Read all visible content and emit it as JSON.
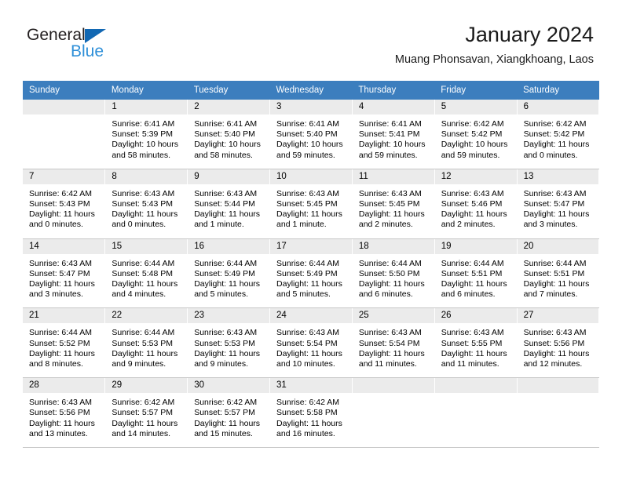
{
  "brand": {
    "name_top": "General",
    "name_bottom": "Blue",
    "triangle_color": "#1268b3",
    "blue_text_color": "#2e8fd8"
  },
  "header": {
    "title": "January 2024",
    "subtitle": "Muang Phonsavan, Xiangkhoang, Laos",
    "header_bg": "#3c7ebe",
    "header_text_color": "#ffffff",
    "daynum_bg": "#ebebeb"
  },
  "weekday_headers": [
    "Sunday",
    "Monday",
    "Tuesday",
    "Wednesday",
    "Thursday",
    "Friday",
    "Saturday"
  ],
  "weeks": [
    [
      {
        "day": "",
        "lines": [
          "",
          "",
          "",
          ""
        ]
      },
      {
        "day": "1",
        "lines": [
          "Sunrise: 6:41 AM",
          "Sunset: 5:39 PM",
          "Daylight: 10 hours",
          "and 58 minutes."
        ]
      },
      {
        "day": "2",
        "lines": [
          "Sunrise: 6:41 AM",
          "Sunset: 5:40 PM",
          "Daylight: 10 hours",
          "and 58 minutes."
        ]
      },
      {
        "day": "3",
        "lines": [
          "Sunrise: 6:41 AM",
          "Sunset: 5:40 PM",
          "Daylight: 10 hours",
          "and 59 minutes."
        ]
      },
      {
        "day": "4",
        "lines": [
          "Sunrise: 6:41 AM",
          "Sunset: 5:41 PM",
          "Daylight: 10 hours",
          "and 59 minutes."
        ]
      },
      {
        "day": "5",
        "lines": [
          "Sunrise: 6:42 AM",
          "Sunset: 5:42 PM",
          "Daylight: 10 hours",
          "and 59 minutes."
        ]
      },
      {
        "day": "6",
        "lines": [
          "Sunrise: 6:42 AM",
          "Sunset: 5:42 PM",
          "Daylight: 11 hours",
          "and 0 minutes."
        ]
      }
    ],
    [
      {
        "day": "7",
        "lines": [
          "Sunrise: 6:42 AM",
          "Sunset: 5:43 PM",
          "Daylight: 11 hours",
          "and 0 minutes."
        ]
      },
      {
        "day": "8",
        "lines": [
          "Sunrise: 6:43 AM",
          "Sunset: 5:43 PM",
          "Daylight: 11 hours",
          "and 0 minutes."
        ]
      },
      {
        "day": "9",
        "lines": [
          "Sunrise: 6:43 AM",
          "Sunset: 5:44 PM",
          "Daylight: 11 hours",
          "and 1 minute."
        ]
      },
      {
        "day": "10",
        "lines": [
          "Sunrise: 6:43 AM",
          "Sunset: 5:45 PM",
          "Daylight: 11 hours",
          "and 1 minute."
        ]
      },
      {
        "day": "11",
        "lines": [
          "Sunrise: 6:43 AM",
          "Sunset: 5:45 PM",
          "Daylight: 11 hours",
          "and 2 minutes."
        ]
      },
      {
        "day": "12",
        "lines": [
          "Sunrise: 6:43 AM",
          "Sunset: 5:46 PM",
          "Daylight: 11 hours",
          "and 2 minutes."
        ]
      },
      {
        "day": "13",
        "lines": [
          "Sunrise: 6:43 AM",
          "Sunset: 5:47 PM",
          "Daylight: 11 hours",
          "and 3 minutes."
        ]
      }
    ],
    [
      {
        "day": "14",
        "lines": [
          "Sunrise: 6:43 AM",
          "Sunset: 5:47 PM",
          "Daylight: 11 hours",
          "and 3 minutes."
        ]
      },
      {
        "day": "15",
        "lines": [
          "Sunrise: 6:44 AM",
          "Sunset: 5:48 PM",
          "Daylight: 11 hours",
          "and 4 minutes."
        ]
      },
      {
        "day": "16",
        "lines": [
          "Sunrise: 6:44 AM",
          "Sunset: 5:49 PM",
          "Daylight: 11 hours",
          "and 5 minutes."
        ]
      },
      {
        "day": "17",
        "lines": [
          "Sunrise: 6:44 AM",
          "Sunset: 5:49 PM",
          "Daylight: 11 hours",
          "and 5 minutes."
        ]
      },
      {
        "day": "18",
        "lines": [
          "Sunrise: 6:44 AM",
          "Sunset: 5:50 PM",
          "Daylight: 11 hours",
          "and 6 minutes."
        ]
      },
      {
        "day": "19",
        "lines": [
          "Sunrise: 6:44 AM",
          "Sunset: 5:51 PM",
          "Daylight: 11 hours",
          "and 6 minutes."
        ]
      },
      {
        "day": "20",
        "lines": [
          "Sunrise: 6:44 AM",
          "Sunset: 5:51 PM",
          "Daylight: 11 hours",
          "and 7 minutes."
        ]
      }
    ],
    [
      {
        "day": "21",
        "lines": [
          "Sunrise: 6:44 AM",
          "Sunset: 5:52 PM",
          "Daylight: 11 hours",
          "and 8 minutes."
        ]
      },
      {
        "day": "22",
        "lines": [
          "Sunrise: 6:44 AM",
          "Sunset: 5:53 PM",
          "Daylight: 11 hours",
          "and 9 minutes."
        ]
      },
      {
        "day": "23",
        "lines": [
          "Sunrise: 6:43 AM",
          "Sunset: 5:53 PM",
          "Daylight: 11 hours",
          "and 9 minutes."
        ]
      },
      {
        "day": "24",
        "lines": [
          "Sunrise: 6:43 AM",
          "Sunset: 5:54 PM",
          "Daylight: 11 hours",
          "and 10 minutes."
        ]
      },
      {
        "day": "25",
        "lines": [
          "Sunrise: 6:43 AM",
          "Sunset: 5:54 PM",
          "Daylight: 11 hours",
          "and 11 minutes."
        ]
      },
      {
        "day": "26",
        "lines": [
          "Sunrise: 6:43 AM",
          "Sunset: 5:55 PM",
          "Daylight: 11 hours",
          "and 11 minutes."
        ]
      },
      {
        "day": "27",
        "lines": [
          "Sunrise: 6:43 AM",
          "Sunset: 5:56 PM",
          "Daylight: 11 hours",
          "and 12 minutes."
        ]
      }
    ],
    [
      {
        "day": "28",
        "lines": [
          "Sunrise: 6:43 AM",
          "Sunset: 5:56 PM",
          "Daylight: 11 hours",
          "and 13 minutes."
        ]
      },
      {
        "day": "29",
        "lines": [
          "Sunrise: 6:42 AM",
          "Sunset: 5:57 PM",
          "Daylight: 11 hours",
          "and 14 minutes."
        ]
      },
      {
        "day": "30",
        "lines": [
          "Sunrise: 6:42 AM",
          "Sunset: 5:57 PM",
          "Daylight: 11 hours",
          "and 15 minutes."
        ]
      },
      {
        "day": "31",
        "lines": [
          "Sunrise: 6:42 AM",
          "Sunset: 5:58 PM",
          "Daylight: 11 hours",
          "and 16 minutes."
        ]
      },
      {
        "day": "",
        "lines": [
          "",
          "",
          "",
          ""
        ]
      },
      {
        "day": "",
        "lines": [
          "",
          "",
          "",
          ""
        ]
      },
      {
        "day": "",
        "lines": [
          "",
          "",
          "",
          ""
        ]
      }
    ]
  ]
}
